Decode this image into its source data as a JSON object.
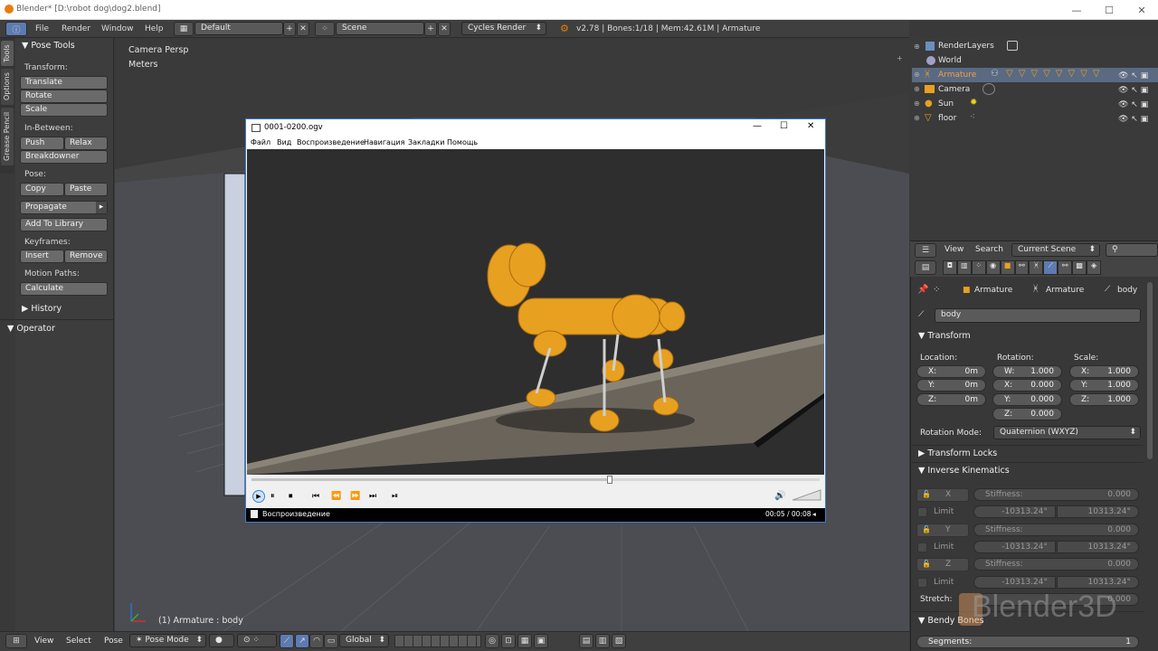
{
  "window": {
    "title": "Blender* [D:\\robot dog\\dog2.blend]"
  },
  "menu": {
    "items": [
      "File",
      "Render",
      "Window",
      "Help"
    ],
    "layout": "Default",
    "scene": "Scene",
    "engine": "Cycles Render",
    "stats": "v2.78 | Bones:1/18 | Mem:42.61M | Armature"
  },
  "vtabs": [
    "Tools",
    "Options",
    "Grease Pencil"
  ],
  "toolshelf": {
    "panel_title": "Pose Tools",
    "transform_label": "Transform:",
    "translate": "Translate",
    "rotate": "Rotate",
    "scale": "Scale",
    "inbetween_label": "In-Between:",
    "push": "Push",
    "relax": "Relax",
    "breakdowner": "Breakdowner",
    "pose_label": "Pose:",
    "copy": "Copy",
    "paste": "Paste",
    "propagate": "Propagate",
    "add_to_library": "Add To Library",
    "keyframes_label": "Keyframes:",
    "insert": "Insert",
    "remove": "Remove",
    "motion_paths_label": "Motion Paths:",
    "calculate": "Calculate",
    "history": "History",
    "operator": "Operator"
  },
  "viewport": {
    "view_name": "Camera Persp",
    "units": "Meters",
    "status": "(1) Armature : body"
  },
  "player": {
    "title": "0001-0200.ogv",
    "menu": [
      "Файл",
      "Вид",
      "Воспроизведение",
      "Навигация",
      "Закладки",
      "Помощь"
    ],
    "status": "Воспроизведение",
    "time": "00:05 / 00:08",
    "progress": 0.63
  },
  "outliner": {
    "items": [
      "RenderLayers",
      "World",
      "Armature",
      "Camera",
      "Sun",
      "floor"
    ]
  },
  "props_header": {
    "view": "View",
    "search": "Search",
    "scene_select": "Current Scene"
  },
  "properties": {
    "breadcrumb": [
      "Armature",
      "Armature",
      "body"
    ],
    "bone_name": "body",
    "transform_title": "Transform",
    "location_label": "Location:",
    "rotation_label": "Rotation:",
    "scale_label": "Scale:",
    "location": [
      {
        "axis": "X:",
        "value": "0m"
      },
      {
        "axis": "Y:",
        "value": "0m"
      },
      {
        "axis": "Z:",
        "value": "0m"
      }
    ],
    "rotation": [
      {
        "axis": "W:",
        "value": "1.000"
      },
      {
        "axis": "X:",
        "value": "0.000"
      },
      {
        "axis": "Y:",
        "value": "0.000"
      },
      {
        "axis": "Z:",
        "value": "0.000"
      }
    ],
    "scale": [
      {
        "axis": "X:",
        "value": "1.000"
      },
      {
        "axis": "Y:",
        "value": "1.000"
      },
      {
        "axis": "Z:",
        "value": "1.000"
      }
    ],
    "rotation_mode_label": "Rotation Mode:",
    "rotation_mode": "Quaternion (WXYZ)",
    "transform_locks": "Transform Locks",
    "ik_title": "Inverse Kinematics",
    "ik_rows": [
      {
        "axis": "X",
        "stiffness": "Stiffness:",
        "stiffness_value": "0.000",
        "limit": "Limit",
        "min": "-10313.24°",
        "max": "10313.24°"
      },
      {
        "axis": "Y",
        "stiffness": "Stiffness:",
        "stiffness_value": "0.000",
        "limit": "Limit",
        "min": "-10313.24°",
        "max": "10313.24°"
      },
      {
        "axis": "Z",
        "stiffness": "Stiffness:",
        "stiffness_value": "0.000",
        "limit": "Limit",
        "min": "-10313.24°",
        "max": "10313.24°"
      }
    ],
    "stretch_label": "Stretch:",
    "stretch_value": "0.000",
    "bendy_bones": "Bendy Bones",
    "segments_label": "Segments:",
    "segments_value": "1"
  },
  "watermark": "Blender3D",
  "bottombar": {
    "view": "View",
    "select": "Select",
    "pose": "Pose",
    "mode": "Pose Mode",
    "orientation": "Global"
  }
}
